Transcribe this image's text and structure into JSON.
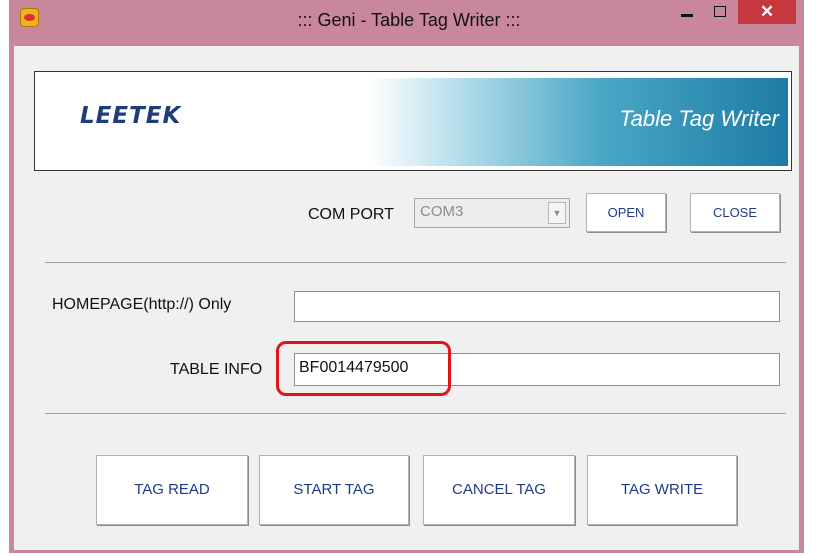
{
  "window": {
    "title": "::: Geni - Table Tag Writer :::",
    "close_glyph": "✕"
  },
  "banner": {
    "logo_text": "LEETEK",
    "title": "Table Tag Writer"
  },
  "com_port": {
    "label": "COM PORT",
    "selected": "COM3",
    "enabled": false,
    "open_label": "OPEN",
    "close_label": "CLOSE"
  },
  "homepage": {
    "label": "HOMEPAGE(http://) Only",
    "value": ""
  },
  "table_info": {
    "label": "TABLE INFO",
    "value": "BF0014479500",
    "highlighted": true,
    "highlight_color": "#e1131b"
  },
  "actions": [
    {
      "label": "TAG READ"
    },
    {
      "label": "START TAG"
    },
    {
      "label": "CANCEL TAG"
    },
    {
      "label": "TAG WRITE"
    }
  ],
  "icons": {
    "app": "app-icon",
    "combo_arrow": "chevron-down-icon"
  }
}
